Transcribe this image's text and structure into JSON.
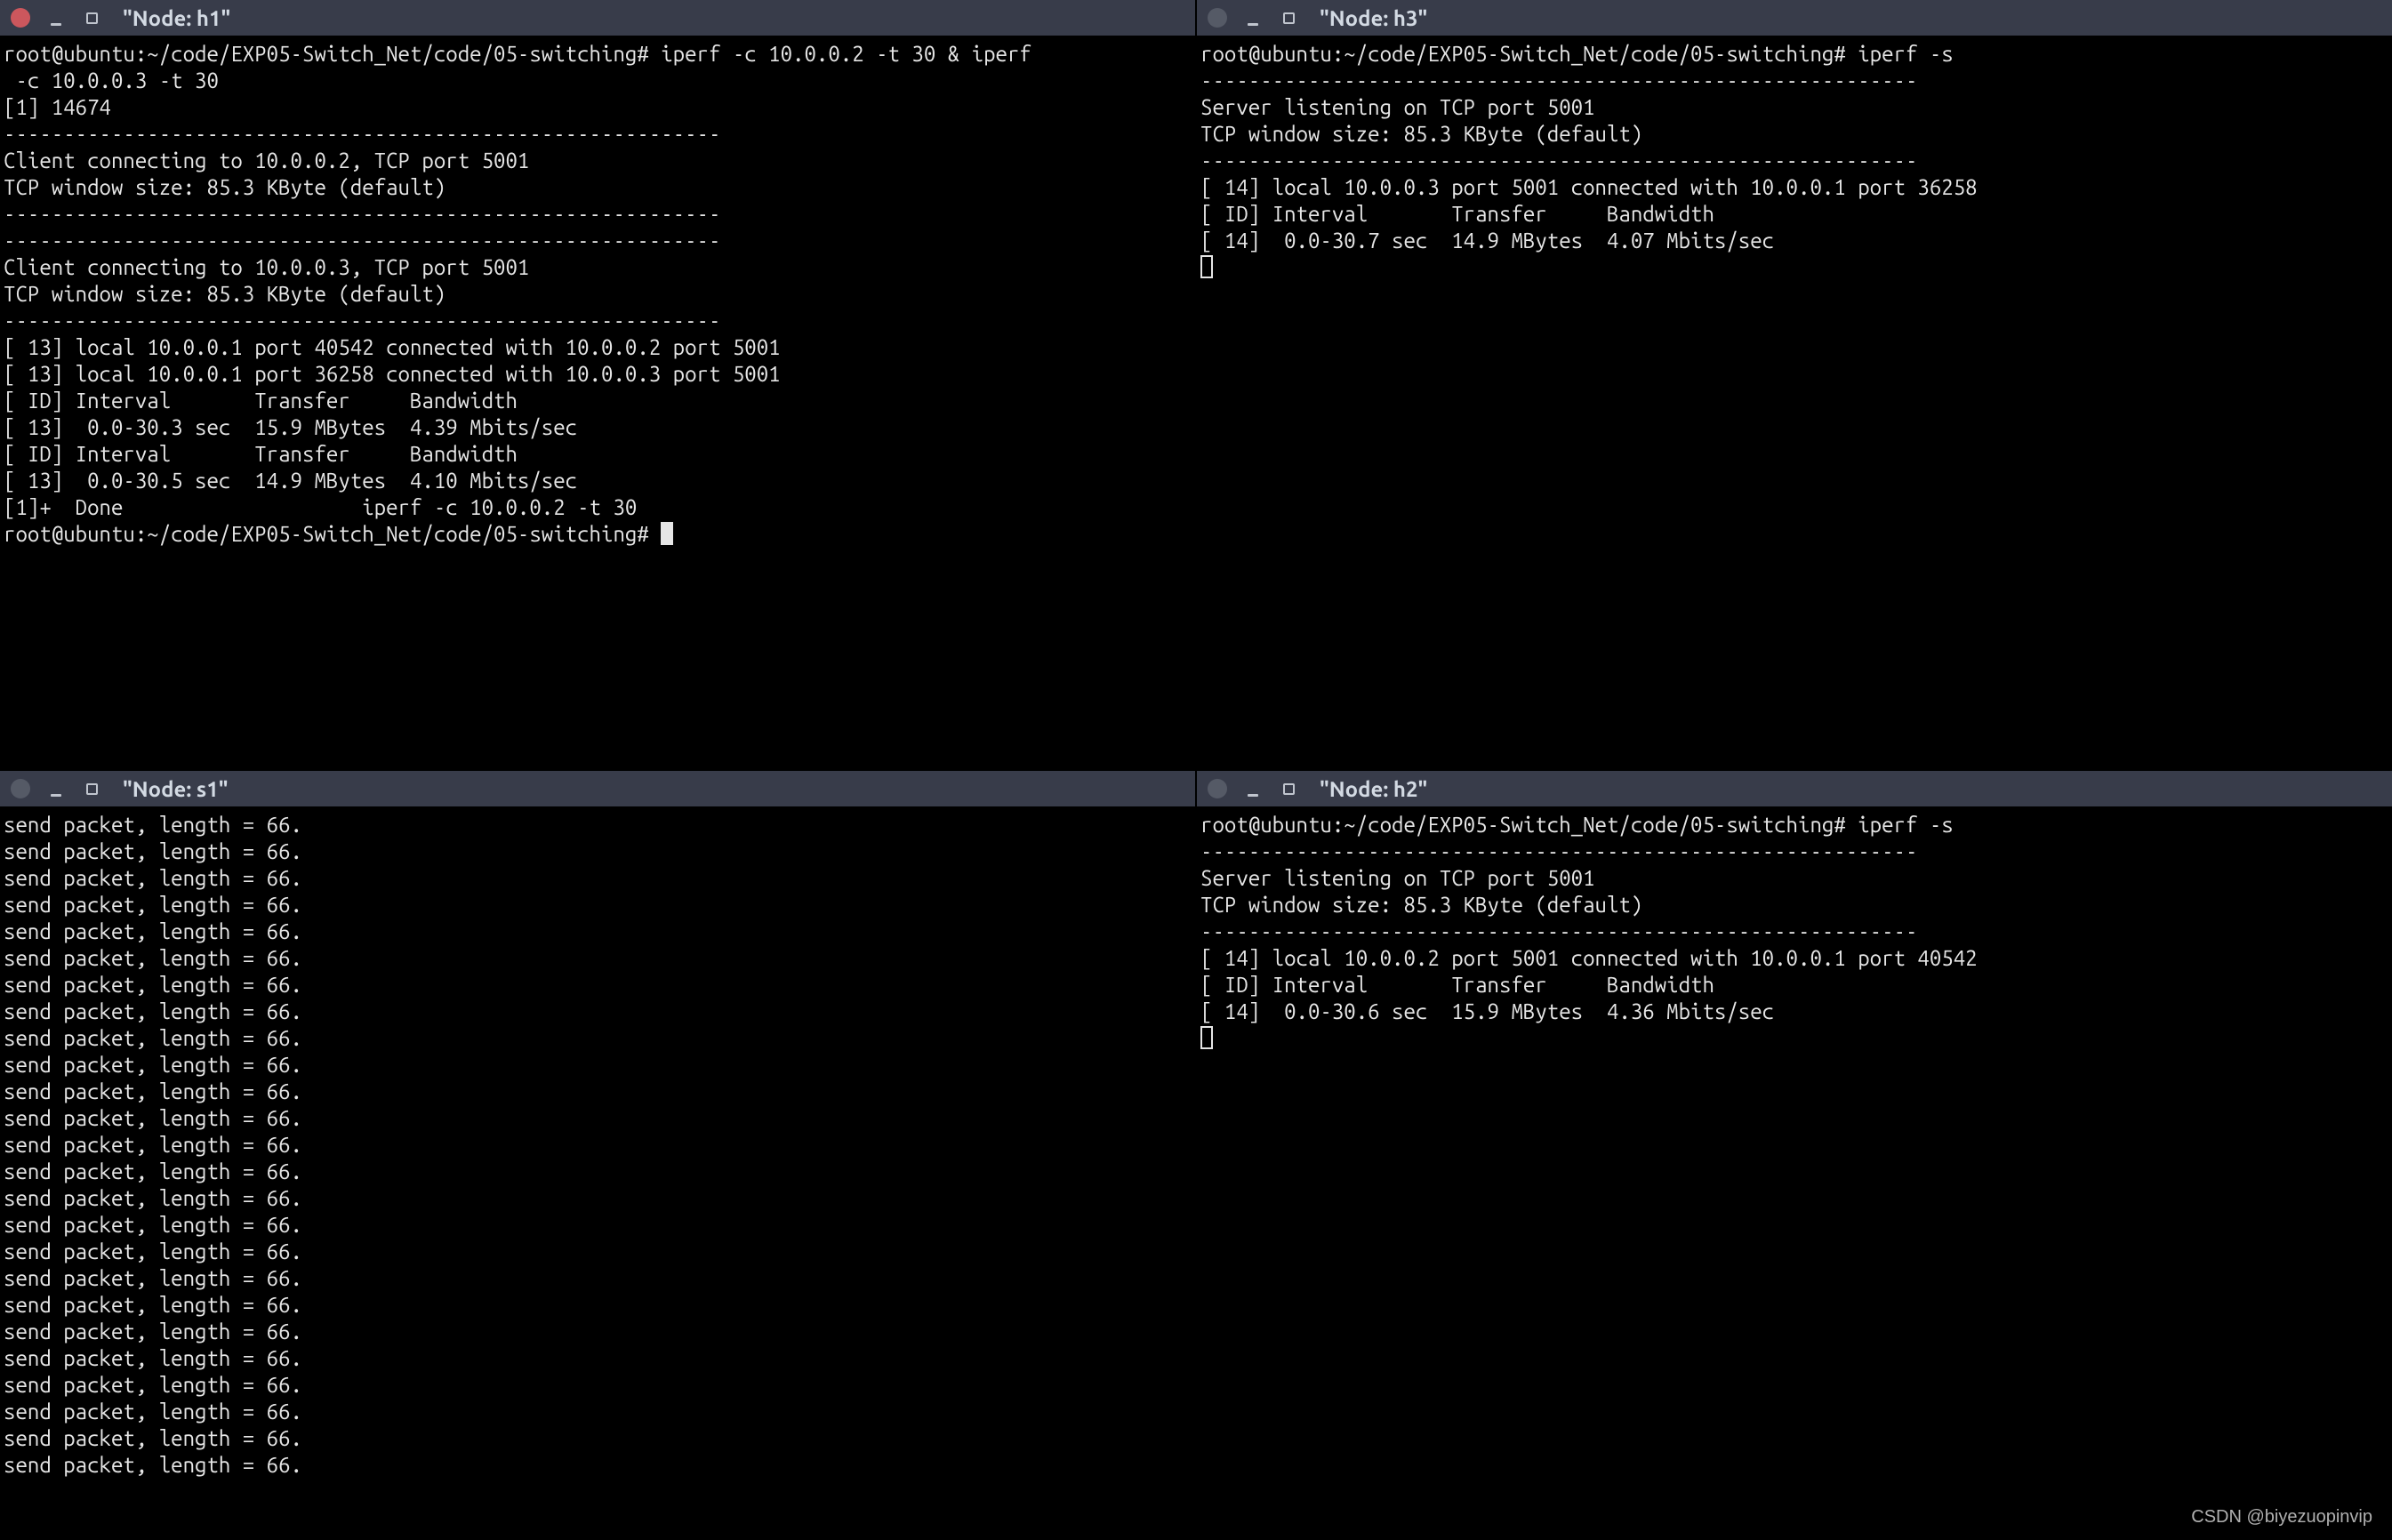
{
  "panes": {
    "h1": {
      "title": "\"Node: h1\"",
      "close_variant": "active",
      "lines": [
        "root@ubuntu:~/code/EXP05-Switch_Net/code/05-switching# iperf -c 10.0.0.2 -t 30 & iperf",
        " -c 10.0.0.3 -t 30",
        "[1] 14674",
        "------------------------------------------------------------",
        "Client connecting to 10.0.0.2, TCP port 5001",
        "TCP window size: 85.3 KByte (default)",
        "------------------------------------------------------------",
        "------------------------------------------------------------",
        "Client connecting to 10.0.0.3, TCP port 5001",
        "TCP window size: 85.3 KByte (default)",
        "------------------------------------------------------------",
        "[ 13] local 10.0.0.1 port 40542 connected with 10.0.0.2 port 5001",
        "[ 13] local 10.0.0.1 port 36258 connected with 10.0.0.3 port 5001",
        "[ ID] Interval       Transfer     Bandwidth",
        "[ 13]  0.0-30.3 sec  15.9 MBytes  4.39 Mbits/sec",
        "[ ID] Interval       Transfer     Bandwidth",
        "[ 13]  0.0-30.5 sec  14.9 MBytes  4.10 Mbits/sec",
        "[1]+  Done                    iperf -c 10.0.0.2 -t 30",
        "root@ubuntu:~/code/EXP05-Switch_Net/code/05-switching# "
      ],
      "trailing_cursor": "block"
    },
    "h3": {
      "title": "\"Node: h3\"",
      "close_variant": "dim",
      "lines": [
        "root@ubuntu:~/code/EXP05-Switch_Net/code/05-switching# iperf -s",
        "------------------------------------------------------------",
        "Server listening on TCP port 5001",
        "TCP window size: 85.3 KByte (default)",
        "------------------------------------------------------------",
        "[ 14] local 10.0.0.3 port 5001 connected with 10.0.0.1 port 36258",
        "[ ID] Interval       Transfer     Bandwidth",
        "[ 14]  0.0-30.7 sec  14.9 MBytes  4.07 Mbits/sec"
      ],
      "trailing_cursor": "outline"
    },
    "s1": {
      "title": "\"Node: s1\"",
      "close_variant": "dim",
      "lines": [
        "send packet, length = 66.",
        "send packet, length = 66.",
        "send packet, length = 66.",
        "send packet, length = 66.",
        "send packet, length = 66.",
        "send packet, length = 66.",
        "send packet, length = 66.",
        "send packet, length = 66.",
        "send packet, length = 66.",
        "send packet, length = 66.",
        "send packet, length = 66.",
        "send packet, length = 66.",
        "send packet, length = 66.",
        "send packet, length = 66.",
        "send packet, length = 66.",
        "send packet, length = 66.",
        "send packet, length = 66.",
        "send packet, length = 66.",
        "send packet, length = 66.",
        "send packet, length = 66.",
        "send packet, length = 66.",
        "send packet, length = 66.",
        "send packet, length = 66.",
        "send packet, length = 66.",
        "send packet, length = 66."
      ],
      "trailing_cursor": "none"
    },
    "h2": {
      "title": "\"Node: h2\"",
      "close_variant": "dim",
      "lines": [
        "root@ubuntu:~/code/EXP05-Switch_Net/code/05-switching# iperf -s",
        "------------------------------------------------------------",
        "Server listening on TCP port 5001",
        "TCP window size: 85.3 KByte (default)",
        "------------------------------------------------------------",
        "[ 14] local 10.0.0.2 port 5001 connected with 10.0.0.1 port 40542",
        "[ ID] Interval       Transfer     Bandwidth",
        "[ 14]  0.0-30.6 sec  15.9 MBytes  4.36 Mbits/sec"
      ],
      "trailing_cursor": "outline"
    }
  },
  "pane_order": [
    "h1",
    "h3",
    "s1",
    "h2"
  ],
  "watermark": "CSDN @biyezuopinvip"
}
